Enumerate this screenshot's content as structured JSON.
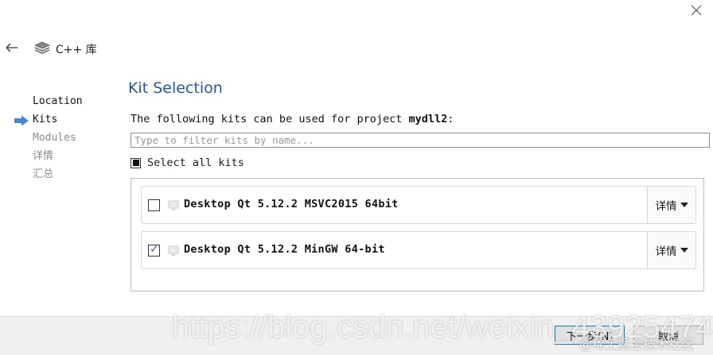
{
  "wizard": {
    "title": "C++ 库"
  },
  "steps": [
    {
      "label": "Location",
      "state": "done"
    },
    {
      "label": "Kits",
      "state": "current"
    },
    {
      "label": "Modules",
      "state": "pending"
    },
    {
      "label": "详情",
      "state": "pending"
    },
    {
      "label": "汇总",
      "state": "pending"
    }
  ],
  "page": {
    "title": "Kit Selection",
    "description_prefix": "The following kits can be used for project ",
    "project_name": "mydll2",
    "description_suffix": ":",
    "filter_placeholder": "Type to filter kits by name...",
    "select_all_label": "Select all kits"
  },
  "kits": [
    {
      "name": "Desktop Qt 5.12.2 MSVC2015 64bit",
      "checked": false,
      "details_label": "详情"
    },
    {
      "name": "Desktop Qt 5.12.2 MinGW 64-bit",
      "checked": true,
      "details_label": "详情"
    }
  ],
  "buttons": {
    "next": "下一步(N)",
    "cancel": "取消"
  },
  "watermark": {
    "url": "https://blog.csdn.net/weixin_43925474",
    "site": "@稀土掘金技术社区"
  },
  "colors": {
    "title": "#1f5aa0",
    "current_step_arrow": "#4a86d8",
    "primary_button_border": "#0078d7"
  }
}
